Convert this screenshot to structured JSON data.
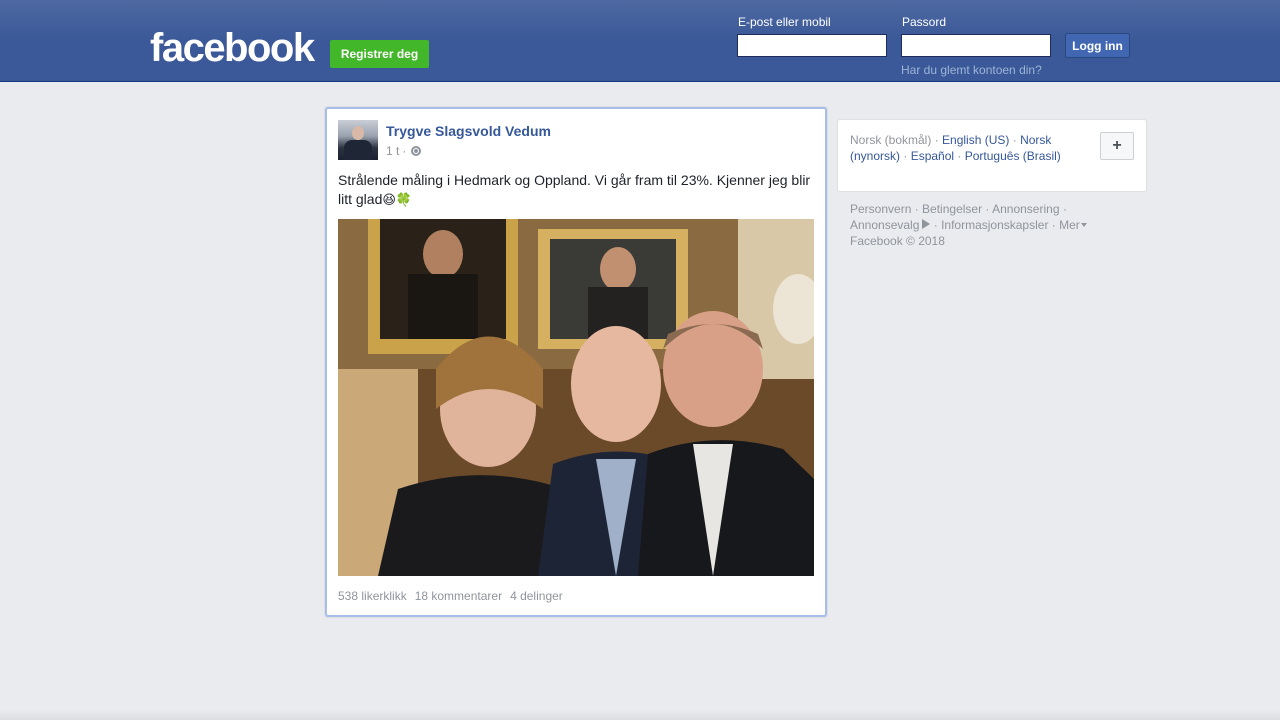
{
  "header": {
    "logo": "facebook",
    "register_label": "Registrer deg",
    "email_label": "E-post eller mobil",
    "email_value": "",
    "password_label": "Passord",
    "password_value": "",
    "login_label": "Logg inn",
    "forgot_label": "Har du glemt kontoen din?",
    "colors": {
      "bar": "#3b5998",
      "register": "#42b72a",
      "login": "#4267b2"
    }
  },
  "post": {
    "author": "Trygve Slagsvold Vedum",
    "time": "1 t",
    "separator": "·",
    "audience_icon": "globe-icon",
    "text": "Strålende måling i Hedmark og Oppland. Vi går fram til 23%. Kjenner jeg blir litt glad",
    "emojis": [
      "😆",
      "🍀"
    ],
    "stats": {
      "likes": "538 likerklikk",
      "comments": "18 kommentarer",
      "shares": "4 delinger"
    }
  },
  "languages": {
    "current": "Norsk (bokmål)",
    "items": [
      "English (US)",
      "Norsk (nynorsk)",
      "Español",
      "Português (Brasil)"
    ],
    "add_icon": "plus-icon"
  },
  "footer": {
    "links": [
      "Personvern",
      "Betingelser",
      "Annonsering",
      "Annonsevalg",
      "Informasjonskapsler",
      "Mer"
    ],
    "copyright": "Facebook © 2018"
  }
}
